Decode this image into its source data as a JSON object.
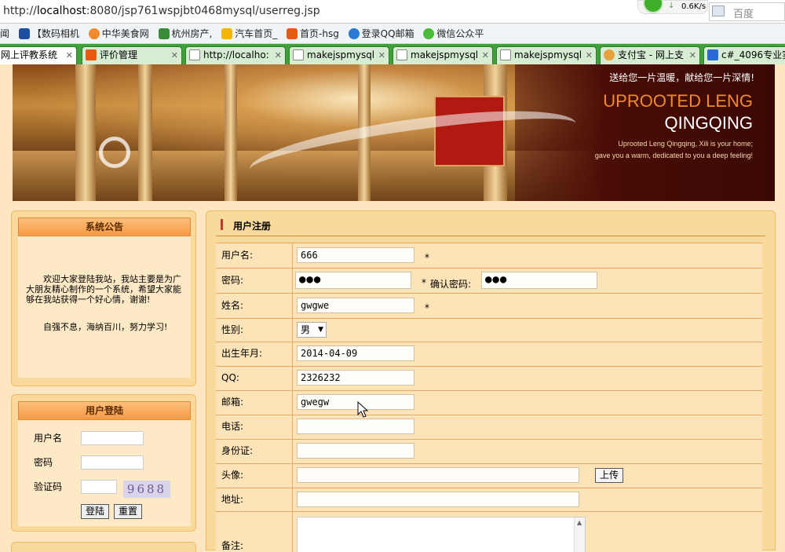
{
  "browser": {
    "url_prefix": "http://",
    "url_host": "localhost",
    "url_rest": ":8080/jsp761wspjbt0468mysql/userreg.jsp",
    "net_speed": "0.6K/s",
    "search_placeholder": "百度",
    "bookmarks": [
      "闻",
      "【数码相机",
      "中华美食网",
      "杭州房产,",
      "汽车首页_",
      "首页-hsg",
      "登录QQ邮箱",
      "微信公众平"
    ],
    "tabs": [
      {
        "label": "网上评教系统",
        "active": true
      },
      {
        "label": "评价管理",
        "active": false
      },
      {
        "label": "http://localho:",
        "active": false
      },
      {
        "label": "makejspmysql",
        "active": false
      },
      {
        "label": "makejspmysql",
        "active": false
      },
      {
        "label": "makejspmysql",
        "active": false
      },
      {
        "label": "支付宝 - 网上支",
        "active": false
      },
      {
        "label": "c#_4096专业实",
        "active": false
      }
    ]
  },
  "banner": {
    "slogan": "送给您一片温暖，献给您一片深情!",
    "title_line1": "UPROOTED LENG",
    "title_line2": "QINGQING",
    "subtitle_line1": "Uprooted Leng Qingqing, Xili is your home;",
    "subtitle_line2": "gave you a warm, dedicated to you a deep feeling!"
  },
  "notice": {
    "title": "系统公告",
    "paragraph1": "欢迎大家登陆我站，我站主要是为广大朋友精心制作的一个系统，希望大家能够在我站获得一个好心情，谢谢!",
    "paragraph2": "自强不息，海纳百川，努力学习!"
  },
  "login": {
    "title": "用户登陆",
    "username_label": "用户名",
    "password_label": "密码",
    "captcha_label": "验证码",
    "captcha_code": "9688",
    "login_button": "登陆",
    "reset_button": "重置"
  },
  "register": {
    "title": "用户注册",
    "fields": {
      "username": {
        "label": "用户名:",
        "value": "666",
        "required": "*"
      },
      "password": {
        "label": "密码:",
        "value": "●●●",
        "required": "*"
      },
      "confirm_password": {
        "label": "确认密码:",
        "value": "●●●"
      },
      "name": {
        "label": "姓名:",
        "value": "gwgwe",
        "required": "*"
      },
      "gender": {
        "label": "性别:",
        "value": "男"
      },
      "birthdate": {
        "label": "出生年月:",
        "value": "2014-04-09"
      },
      "qq": {
        "label": "QQ:",
        "value": "2326232"
      },
      "email": {
        "label": "邮箱:",
        "value": "gwegw"
      },
      "phone": {
        "label": "电话:",
        "value": ""
      },
      "id_card": {
        "label": "身份证:",
        "value": ""
      },
      "avatar": {
        "label": "头像:",
        "value": "",
        "upload_button": "上传"
      },
      "address": {
        "label": "地址:",
        "value": ""
      },
      "remark": {
        "label": "备注:",
        "value": ""
      }
    }
  }
}
